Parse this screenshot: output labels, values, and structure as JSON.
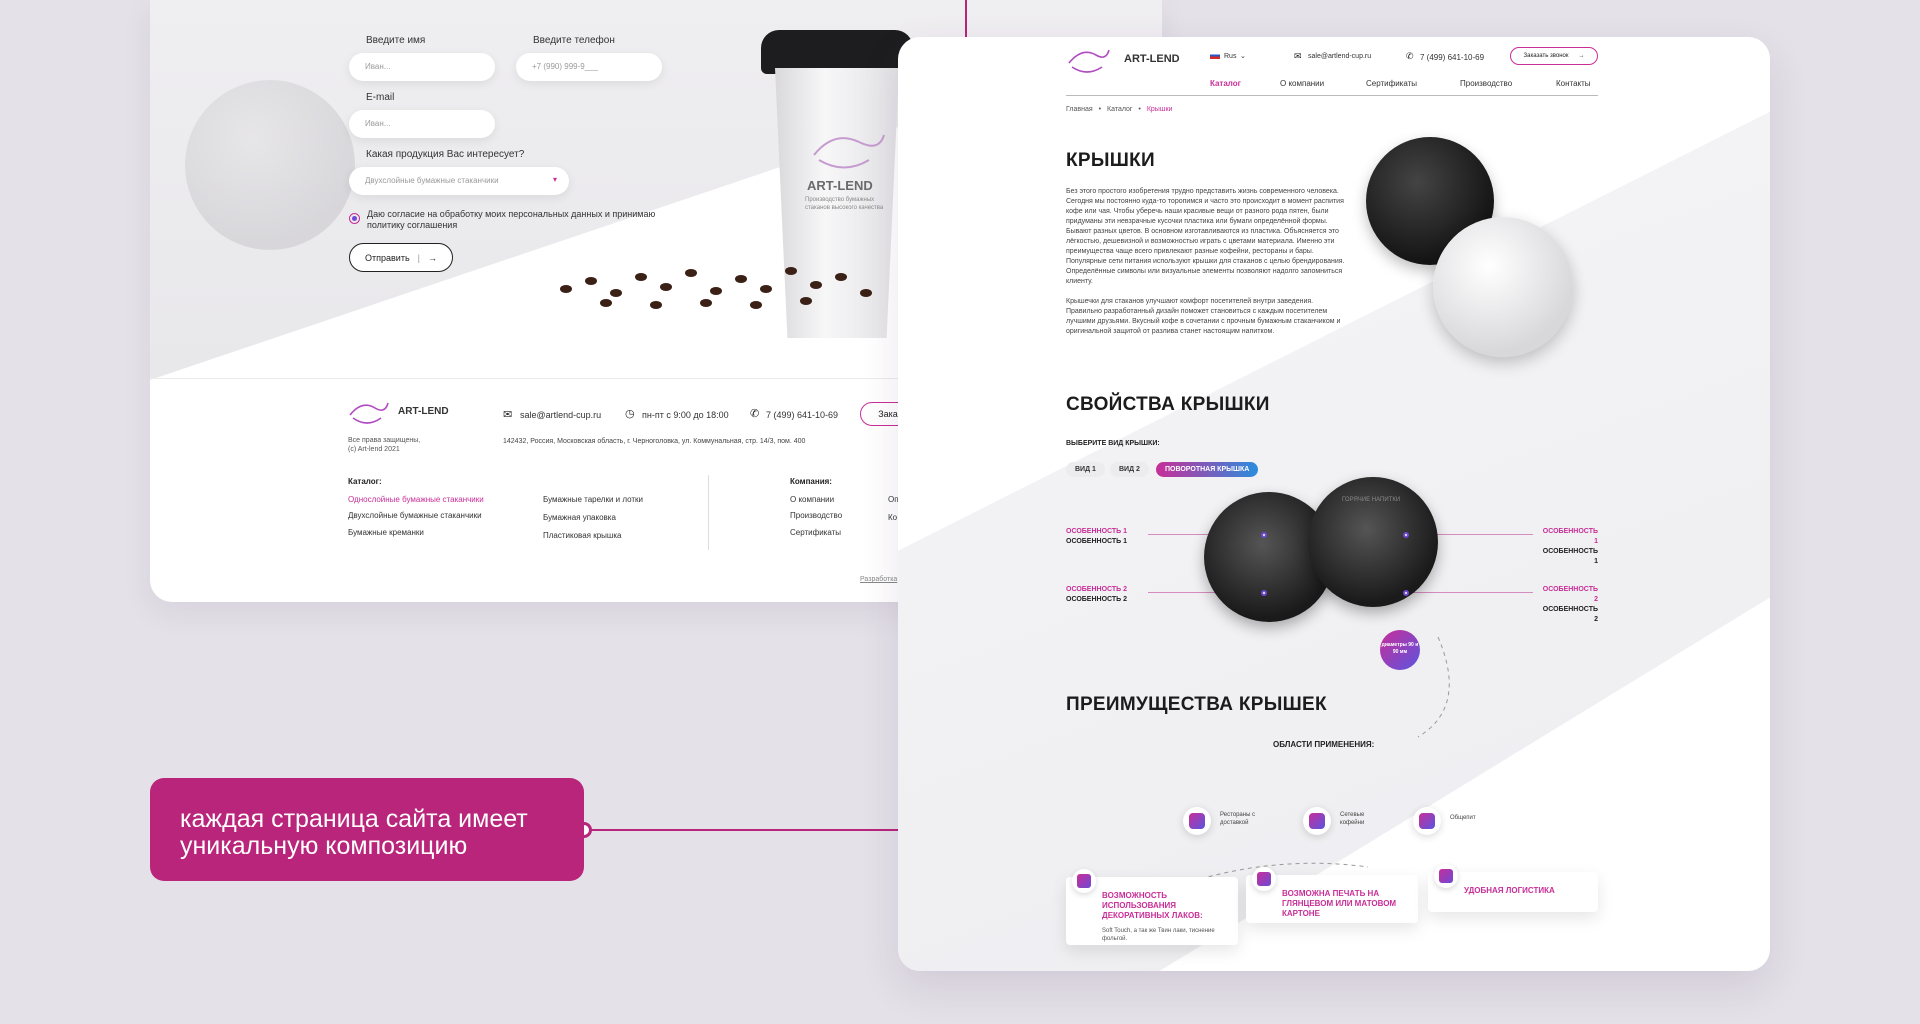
{
  "form": {
    "name_label": "Введите имя",
    "name_placeholder": "Иван...",
    "phone_label": "Введите телефон",
    "phone_placeholder": "+7 (990) 999-9___",
    "email_label": "E-mail",
    "email_placeholder": "Иван...",
    "product_label": "Какая продукция Вас интересует?",
    "product_selected": "Двухслойные бумажные стаканчики",
    "consent_text": "Даю согласие на обработку моих персональных данных и принимаю политику соглашения",
    "submit_label": "Отправить"
  },
  "cup_brand": {
    "name": "ART-LEND",
    "tagline": "Производство бумажных стаканов высокого качества"
  },
  "footer": {
    "brand": "ART-LEND",
    "rights": "Все права защищены,",
    "copyright": "(c) Art-lend 2021",
    "email": "sale@artlend-cup.ru",
    "hours": "пн-пт с 9:00 до 18:00",
    "phone": "7 (499) 641-10-69",
    "order_btn": "Заказ",
    "address": "142432, Россия, Московская область, г. Черноголовка, ул. Коммунальная, стр. 14/3, пом. 400",
    "catalog_title": "Каталог:",
    "catalog_col1": [
      "Однослойные бумажные стаканчики",
      "Двухслойные бумажные стаканчики",
      "Бумажные креманки"
    ],
    "catalog_col2": [
      "Бумажные тарелки и лотки",
      "Бумажная упаковка",
      "Пластиковая крышка"
    ],
    "company_title": "Компания:",
    "company_items": [
      "О компании",
      "Производство",
      "Сертификаты"
    ],
    "company_col2": [
      "Оп",
      "Ко"
    ],
    "dev_link": "Разработка"
  },
  "header": {
    "brand": "ART-LEND",
    "lang": "Rus",
    "email": "sale@artlend-cup.ru",
    "phone": "7 (499) 641-10-69",
    "call_btn": "Заказать звонок",
    "nav": [
      "Каталог",
      "О компании",
      "Сертификаты",
      "Производство",
      "Контакты"
    ]
  },
  "breadcrumb": [
    "Главная",
    "Каталог",
    "Крышки"
  ],
  "main": {
    "title": "КРЫШКИ",
    "para1": "Без этого простого изобретения трудно представить жизнь современного человека. Сегодня мы постоянно куда-то торопимся и часто это происходит в момент распития кофе или чая. Чтобы уберечь наши красивые вещи от разного рода пятен, были придуманы эти невзрачные кусочки пластика или бумаги определённой формы. Бывают разных цветов. В основном изготавливаются из пластика. Объясняется это лёгкостью, дешевизной и возможностью играть с цветами материала. Именно эти преимущества чаще всего привлекают разные кофейни, рестораны и бары. Популярные сети питания используют крышки для стаканов с целью брендирования. Определённые символы или визуальные элементы позволяют надолго запомниться клиенту.",
    "para2": "Крышечки для стаканов улучшают комфорт посетителей внутри заведения. Правильно разработанный дизайн поможет становиться с каждым посетителем лучшими друзьями. Вкусный кофе в сочетании с прочным бумажным стаканчиком и оригинальной защитой от разлива станет настоящим напитком."
  },
  "properties": {
    "title": "СВОЙСТВА КРЫШКИ",
    "choose_label": "ВЫБЕРИТЕ ВИД КРЫШКИ:",
    "tabs": [
      "ВИД 1",
      "ВИД 2",
      "ПОВОРОТНАЯ КРЫШКА"
    ],
    "feature_pink": "ОСОБЕННОСТЬ 1",
    "feature_black": "ОСОБЕННОСТЬ 1",
    "feature2_pink": "ОСОБЕННОСТЬ 2",
    "feature2_black": "ОСОБЕННОСТЬ 2",
    "diameter_badge": "диаметры 90 и 90 мм",
    "lid_text": "ГОРЯЧИЕ НАПИТКИ"
  },
  "advantages": {
    "title": "ПРЕИМУЩЕСТВА КРЫШЕК",
    "areas_label": "ОБЛАСТИ ПРИМЕНЕНИЯ:",
    "areas": [
      "Рестораны с доставкой",
      "Сетевые кофейни",
      "Общепит"
    ],
    "cards": [
      {
        "title": "ВОЗМОЖНОСТЬ ИСПОЛЬЗОВАНИЯ ДЕКОРАТИВНЫХ ЛАКОВ:",
        "desc": "Soft Touch, а так же Твин лаки, тиснение фольгой."
      },
      {
        "title": "ВОЗМОЖНА ПЕЧАТЬ НА ГЛЯНЦЕВОМ ИЛИ МАТОВОМ КАРТОНЕ",
        "desc": ""
      },
      {
        "title": "УДОБНАЯ ЛОГИСТИКА",
        "desc": ""
      }
    ]
  },
  "callout": "каждая страница сайта имеет уникальную композицию",
  "colors": {
    "accent": "#c82e98",
    "callout": "#b8257a",
    "background": "#e4e1e8"
  }
}
